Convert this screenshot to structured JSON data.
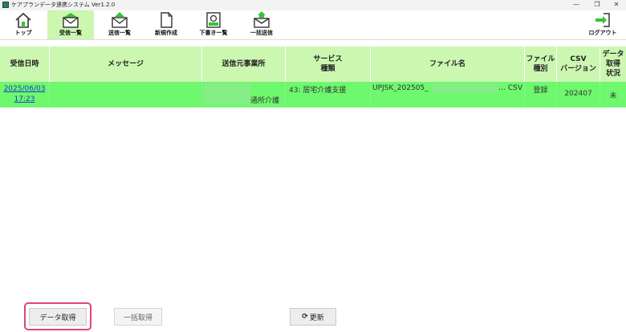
{
  "window": {
    "title": "ケアプランデータ連携システム Ver1.2.0",
    "minimize": "—",
    "restore": "❐",
    "close": "✕"
  },
  "toolbar": {
    "items": [
      {
        "label": "トップ",
        "icon": "home-icon"
      },
      {
        "label": "受信一覧",
        "icon": "inbox-icon"
      },
      {
        "label": "送信一覧",
        "icon": "sent-icon"
      },
      {
        "label": "新規作成",
        "icon": "new-document-icon"
      },
      {
        "label": "下書き一覧",
        "icon": "draft-icon"
      },
      {
        "label": "一括送信",
        "icon": "bulk-send-icon"
      },
      {
        "label": "ログアウト",
        "icon": "logout-icon"
      }
    ],
    "active_index": 1
  },
  "table": {
    "columns": [
      "受信日時",
      "メッセージ",
      "送信元事業所",
      "サービス\n種類",
      "ファイル名",
      "ファイル\n種別",
      "CSV\nバージョン",
      "データ\n取得\n状況"
    ],
    "rows": [
      {
        "date": "2025/06/03",
        "time": "17:23",
        "message": "",
        "sender_suffix": "通所介護",
        "service": "43: 居宅介護支援",
        "file_prefix": "UPJSK_202505_",
        "file_suffix": "… CSV",
        "file_type": "登録",
        "csv_version": "202407",
        "status": "未"
      }
    ]
  },
  "buttons": {
    "fetch": "データ取得",
    "bulk_fetch": "一括取得",
    "refresh_icon": "⟳",
    "refresh": "更新"
  },
  "colors": {
    "header_bg": "#ccf7b1",
    "row_selected_bg": "#6ef86e",
    "icon_green": "#38c238",
    "highlight": "#e0447b",
    "link": "#1a3ccc"
  }
}
